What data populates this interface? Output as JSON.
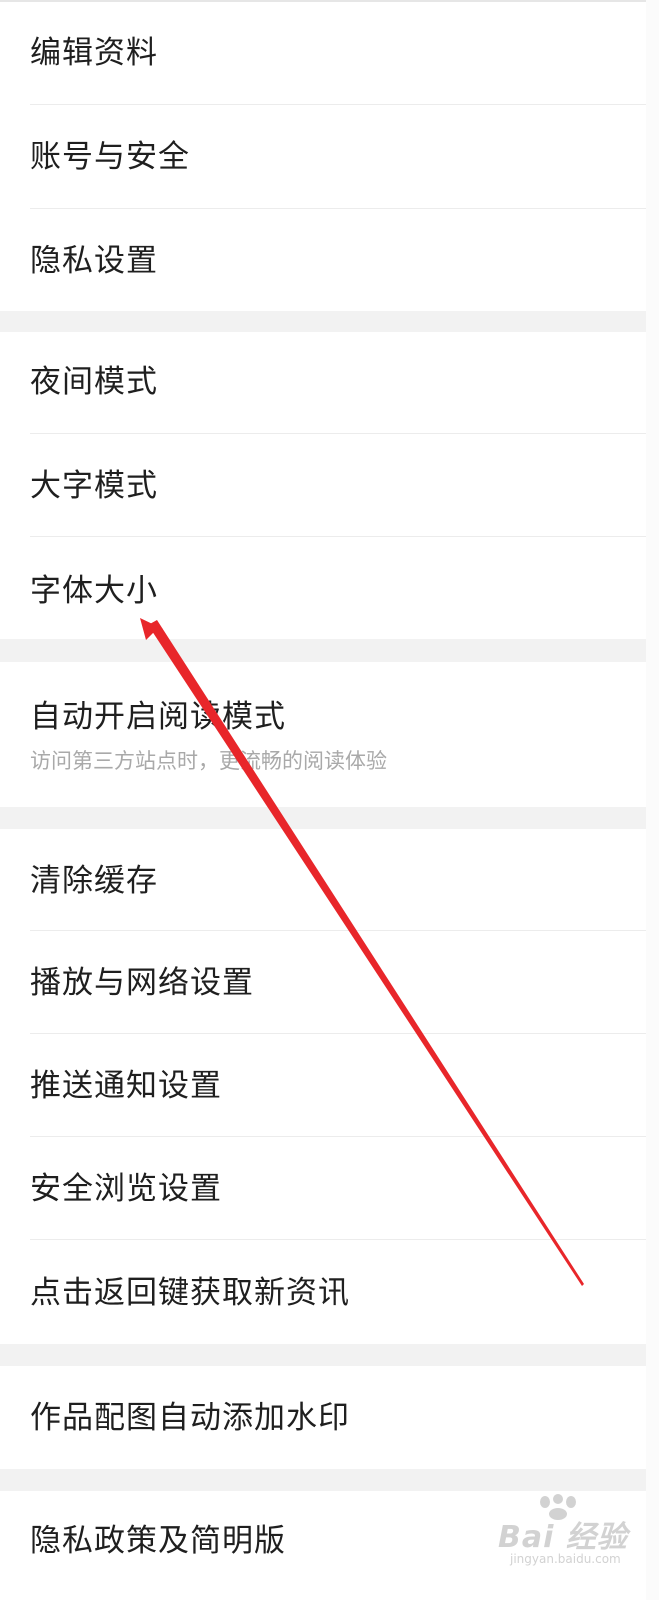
{
  "settings": {
    "group1": {
      "edit_profile": "编辑资料",
      "account_security": "账号与安全",
      "privacy_settings": "隐私设置"
    },
    "group2": {
      "night_mode": "夜间模式",
      "large_font_mode": "大字模式",
      "font_size": "字体大小"
    },
    "group3": {
      "auto_reading_mode": "自动开启阅读模式",
      "auto_reading_mode_desc": "访问第三方站点时，更流畅的阅读体验"
    },
    "group4": {
      "clear_cache": "清除缓存",
      "playback_network": "播放与网络设置",
      "push_notifications": "推送通知设置",
      "safe_browsing": "安全浏览设置",
      "back_key_refresh": "点击返回键获取新资讯"
    },
    "group5": {
      "auto_watermark": "作品配图自动添加水印"
    },
    "group6": {
      "privacy_policy": "隐私政策及简明版"
    }
  },
  "annotation": {
    "arrow_color": "#e8262a"
  },
  "watermark": {
    "logo_text": "Bai 经验",
    "url_text": "jingyan.baidu.com"
  },
  "colors": {
    "background": "#f2f2f2",
    "item_background": "#ffffff",
    "text_primary": "#1f1f1f",
    "text_secondary": "#a9a9a9",
    "divider": "#ececec"
  }
}
